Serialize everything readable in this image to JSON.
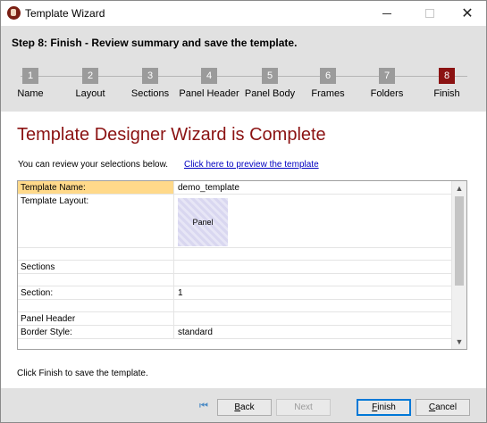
{
  "window": {
    "title": "Template Wizard"
  },
  "header": {
    "step_title": "Step 8: Finish - Review summary and save the template.",
    "steps": [
      {
        "num": "1",
        "label": "Name"
      },
      {
        "num": "2",
        "label": "Layout"
      },
      {
        "num": "3",
        "label": "Sections"
      },
      {
        "num": "4",
        "label": "Panel Header"
      },
      {
        "num": "5",
        "label": "Panel Body"
      },
      {
        "num": "6",
        "label": "Frames"
      },
      {
        "num": "7",
        "label": "Folders"
      },
      {
        "num": "8",
        "label": "Finish"
      }
    ],
    "active_step": 8
  },
  "content": {
    "title": "Template Designer Wizard is Complete",
    "review_text": "You can review your selections below.",
    "preview_link": "Click here to preview the template",
    "rows": [
      {
        "key": "Template Name:",
        "value": "demo_template"
      },
      {
        "key": "Template Layout:",
        "value": "",
        "thumb": "Panel"
      },
      {
        "key": "",
        "value": ""
      },
      {
        "key": "Sections",
        "value": ""
      },
      {
        "key": "",
        "value": ""
      },
      {
        "key": "Section:",
        "value": "1"
      },
      {
        "key": "",
        "value": ""
      },
      {
        "key": "Panel Header",
        "value": ""
      },
      {
        "key": "Border Style:",
        "value": "standard"
      }
    ],
    "finish_note": "Click Finish to save the template."
  },
  "footer": {
    "back": {
      "prefix": "",
      "accel": "B",
      "rest": "ack"
    },
    "next": "Next",
    "finish": {
      "prefix": "",
      "accel": "F",
      "rest": "inish"
    },
    "cancel": {
      "prefix": "",
      "accel": "C",
      "rest": "ancel"
    }
  },
  "colors": {
    "accent": "#8b1212",
    "selected_row": "#ffd98a",
    "link": "#0000c0",
    "step_inactive": "#9b9b9b"
  },
  "icons": [
    "app-icon",
    "minimize-icon",
    "maximize-icon",
    "close-icon",
    "scroll-up-icon",
    "scroll-down-icon",
    "first-page-icon"
  ]
}
